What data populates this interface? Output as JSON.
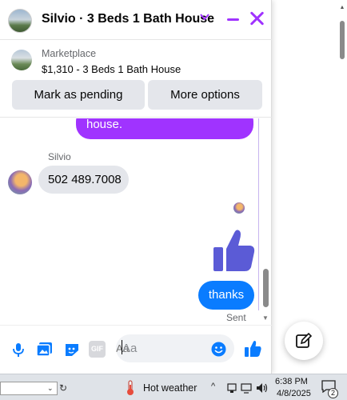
{
  "chat": {
    "title": "Silvio · 3 Beds 1 Bath House",
    "marketplace_label": "Marketplace",
    "listing": "$1,310 - 3 Beds 1 Bath House",
    "buttons": {
      "pending": "Mark as pending",
      "more": "More options"
    },
    "messages": {
      "partial_outgoing": "house.",
      "sender_name": "Silvio",
      "incoming": "502 489.7008",
      "outgoing": "thanks",
      "status": "Sent"
    },
    "composer": {
      "placeholder": "Aa",
      "gif_label": "GIF"
    },
    "colors": {
      "accent": "#a033ff",
      "outgoing": "#0a7cff",
      "like": "#0a7cff",
      "thumb_big": "#5b5bd6"
    }
  },
  "taskbar": {
    "weather": "Hot weather",
    "time": "6:38 PM",
    "date": "4/8/2025",
    "notification_count": "2"
  }
}
